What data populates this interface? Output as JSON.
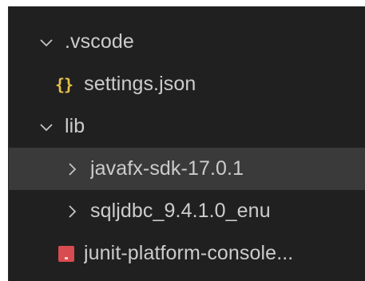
{
  "explorer": {
    "items": [
      {
        "label": ".vscode",
        "type": "folder",
        "expanded": true,
        "icon": "chevron-down-icon"
      },
      {
        "label": "settings.json",
        "type": "file",
        "icon": "json-braces-icon",
        "icon_text": "{}",
        "icon_color": "#e8c04a"
      },
      {
        "label": "lib",
        "type": "folder",
        "expanded": true,
        "icon": "chevron-down-icon"
      },
      {
        "label": "javafx-sdk-17.0.1",
        "type": "folder",
        "expanded": false,
        "selected": true,
        "icon": "chevron-right-icon"
      },
      {
        "label": "sqljdbc_9.4.1.0_enu",
        "type": "folder",
        "expanded": false,
        "icon": "chevron-right-icon"
      },
      {
        "label": "junit-platform-console...",
        "type": "file",
        "icon": "jar-file-icon",
        "icon_color": "#d84b50"
      }
    ]
  },
  "colors": {
    "background": "#202020",
    "selected_row": "#3a3a3a",
    "text": "#cccccc"
  }
}
